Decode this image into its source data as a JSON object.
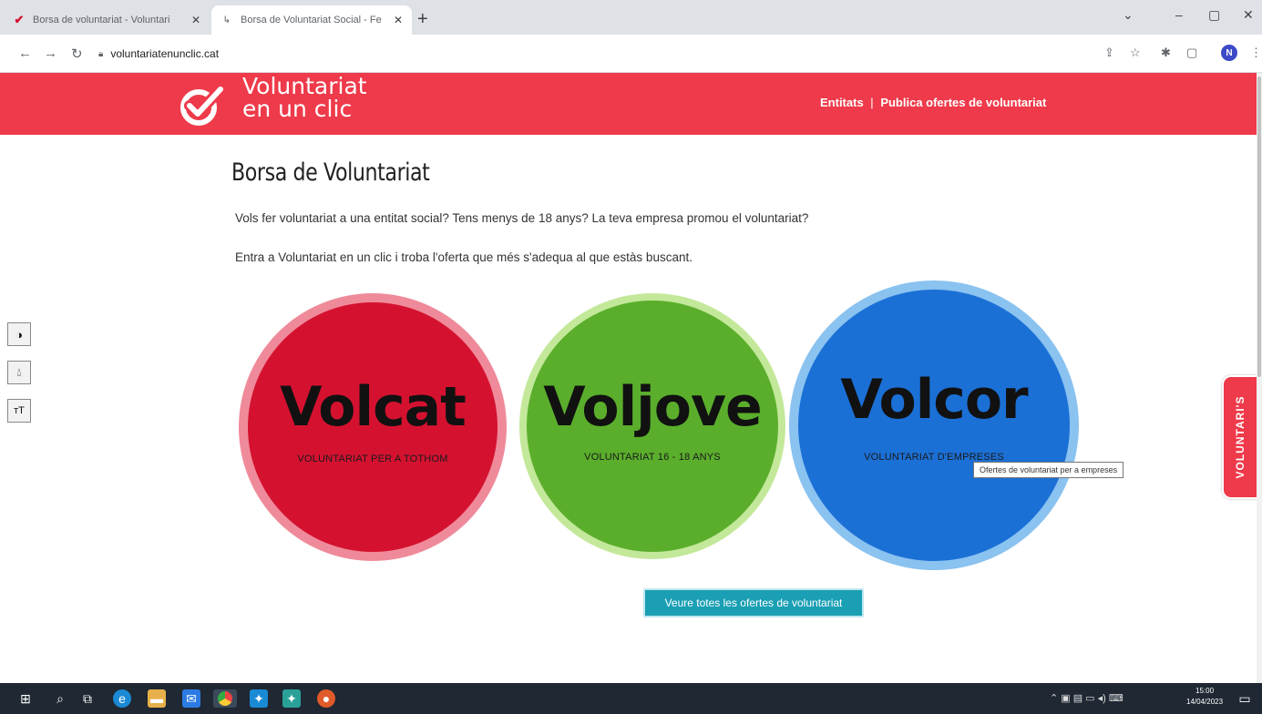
{
  "browser": {
    "tabs": [
      {
        "title": "Borsa de voluntariat - Voluntari",
        "favicon": "check-favicon",
        "color": "#d41230"
      },
      {
        "title": "Borsa de Voluntariat Social - Fe",
        "favicon": "link-favicon",
        "color": "#888888"
      }
    ],
    "url": "voluntariatenunclic.cat",
    "profile_initial": "N"
  },
  "site": {
    "logo_line1": "Voluntariat",
    "logo_line2": "en un clic",
    "nav_entitats": "Entitats",
    "nav_separator": "|",
    "nav_publica": "Publica ofertes de voluntariat",
    "brand_color": "#ee3a4a"
  },
  "main": {
    "title": "Borsa de Voluntariat",
    "intro1": "Vols fer voluntariat a una entitat social? Tens menys de 18 anys? La teva empresa promou el voluntariat?",
    "intro2": "Entra a Voluntariat en un clic i troba l'oferta que més s'adequa al que estàs buscant.",
    "circles": [
      {
        "name": "Volcat",
        "subtitle": "VOLUNTARIAT PER A TOTHOM",
        "color": "#d41230"
      },
      {
        "name": "Voljove",
        "subtitle": "VOLUNTARIAT 16 - 18 ANYS",
        "color": "#5aae2c"
      },
      {
        "name": "Volcor",
        "subtitle": "VOLUNTARIAT D'EMPRESES",
        "color": "#1b70d6"
      }
    ],
    "tooltip": "Ofertes de voluntariat per a empreses",
    "cta": "Veure totes les ofertes de voluntariat"
  },
  "sidetab": {
    "label": "VOLUNTARI'S"
  },
  "a11y_tools": [
    "contrast-icon",
    "drop-icon",
    "text-size-icon"
  ],
  "taskbar": {
    "time": "15:00",
    "date": "14/04/2023"
  }
}
